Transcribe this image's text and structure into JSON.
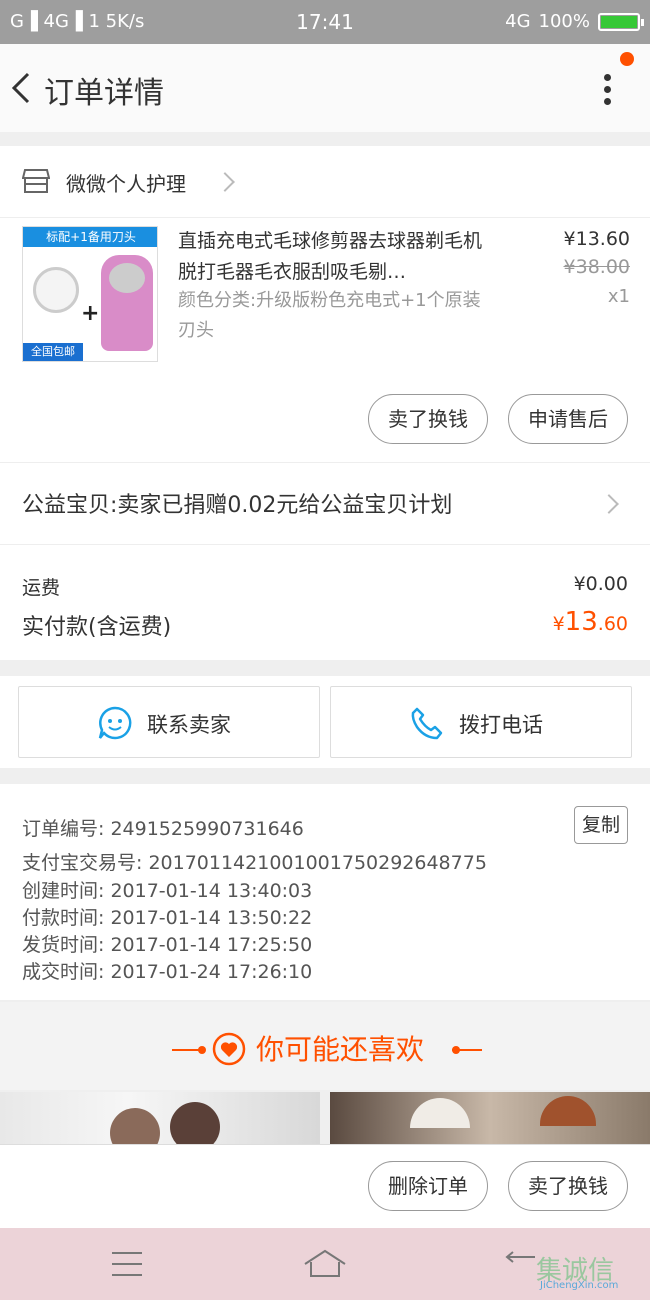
{
  "status_bar": {
    "left": "G▐ 4G▐ 1 ",
    "speed": "5K/s",
    "time": "17:41",
    "network": "4G",
    "battery": "100%",
    "battery_level": 1.0
  },
  "nav": {
    "title": "订单详情"
  },
  "shop": {
    "name": "微微个人护理"
  },
  "product": {
    "image_tag_top": "标配+1备用刀头",
    "image_tag_bottom": "全国包邮",
    "title": "直插充电式毛球修剪器去球器剃毛机脱打毛器毛衣服刮吸毛剔…",
    "sku": "颜色分类:升级版粉色充电式+1个原装刃头",
    "price": "¥13.60",
    "original_price": "¥38.00",
    "quantity": "x1"
  },
  "product_actions": {
    "sell_label": "卖了换钱",
    "after_sale_label": "申请售后"
  },
  "charity": {
    "text": "公益宝贝:卖家已捐赠0.02元给公益宝贝计划"
  },
  "totals": {
    "shipping_label": "运费",
    "shipping_value": "¥0.00",
    "paid_label": "实付款(含运费)",
    "paid_currency": "¥",
    "paid_integer": "13",
    "paid_decimal": "60"
  },
  "contact": {
    "seller_label": "联系卖家",
    "call_label": "拨打电话"
  },
  "order_info": {
    "order_no": "订单编号: 2491525990731646",
    "copy_label": "复制",
    "alipay_no": "支付宝交易号: 2017011421001001750292648775",
    "created": "创建时间: 2017-01-14  13:40:03",
    "paid": "付款时间: 2017-01-14  13:50:22",
    "shipped": "发货时间: 2017-01-14  17:25:50",
    "completed": "成交时间: 2017-01-24  17:26:10"
  },
  "recommend": {
    "title": "你可能还喜欢"
  },
  "bottom_actions": {
    "delete_label": "删除订单",
    "sell_label": "卖了换钱"
  },
  "watermark": {
    "text": "集诚信",
    "url": "JiChengXin.com"
  },
  "colors": {
    "accent": "#ff5000",
    "status_bar": "#9e9e9e",
    "system_nav": "#ecd3d8",
    "contact_icon": "#1aa1e6"
  },
  "icons": [
    "back-icon",
    "more-icon",
    "shop-icon",
    "chevron-right-icon",
    "chat-icon",
    "phone-icon",
    "heart-icon",
    "menu-icon",
    "home-icon",
    "return-icon"
  ]
}
